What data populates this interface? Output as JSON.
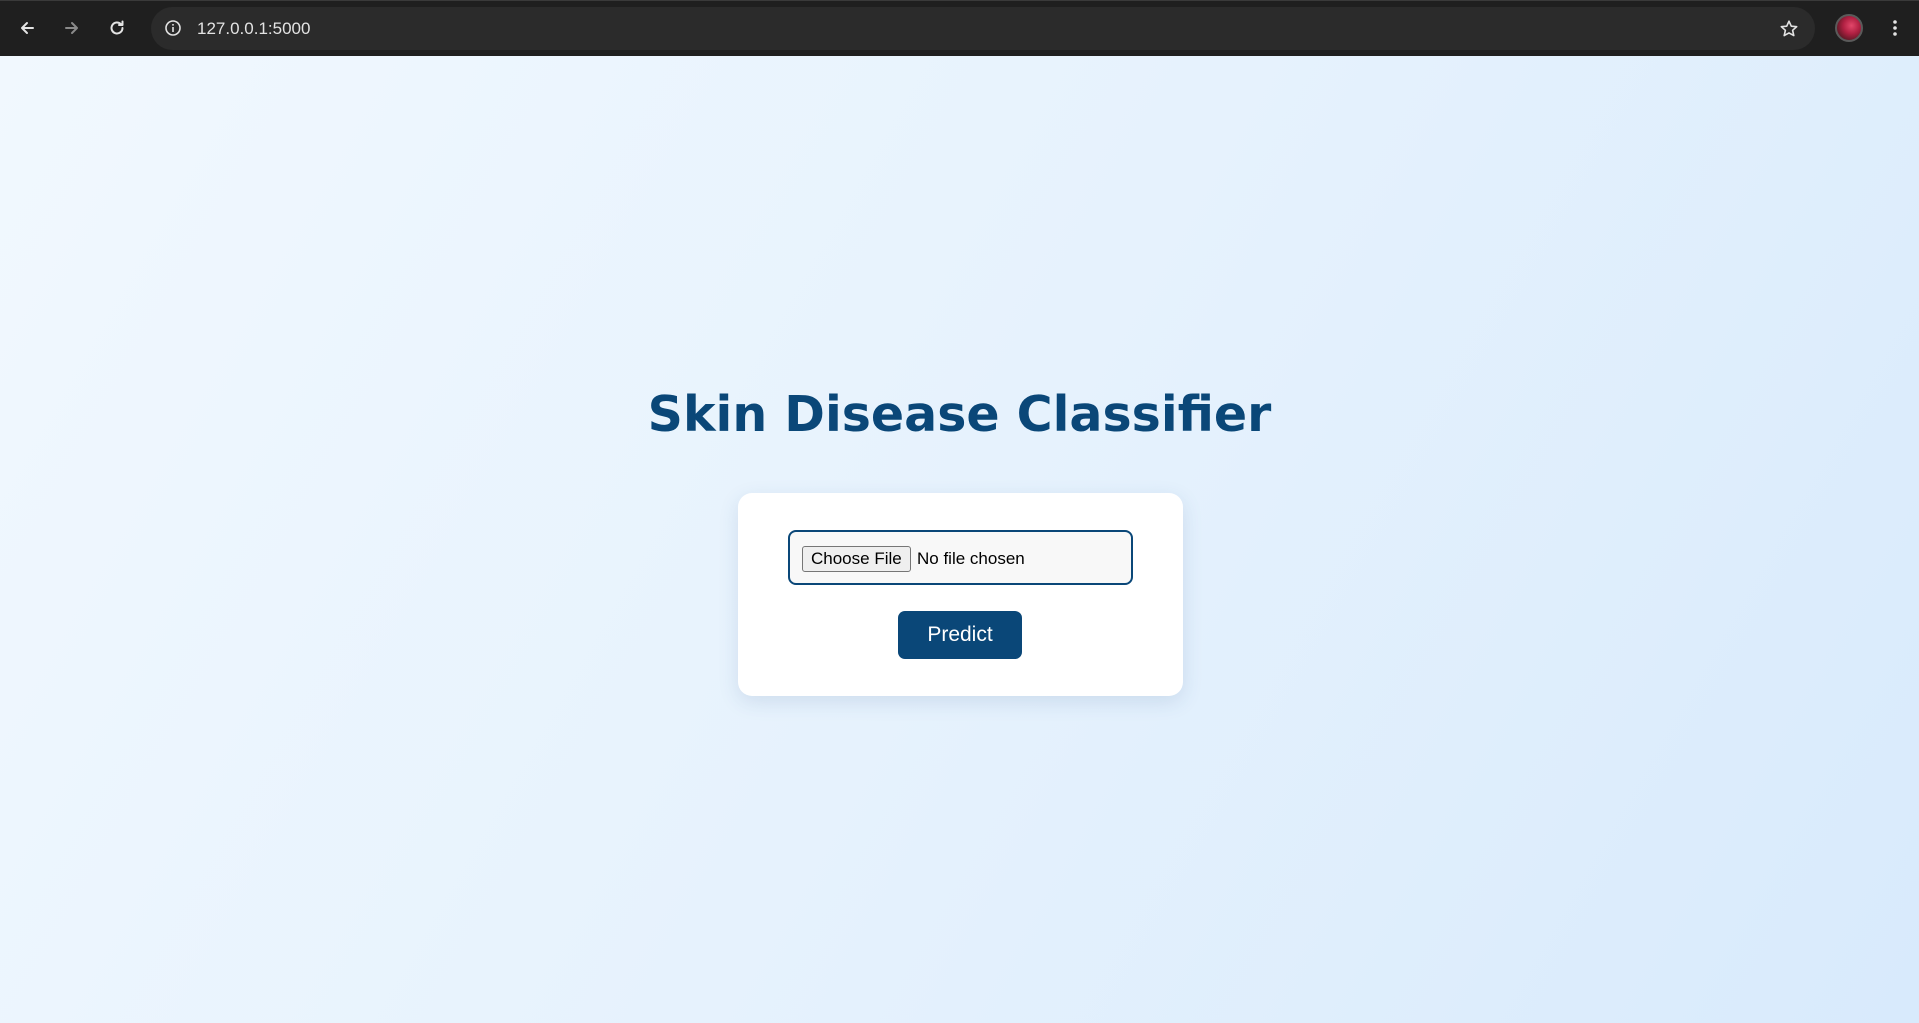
{
  "browser": {
    "url": "127.0.0.1:5000",
    "icons": {
      "back": "arrow-left-icon",
      "forward": "arrow-right-icon",
      "reload": "reload-icon",
      "site_info": "info-icon",
      "bookmark": "star-icon",
      "menu": "kebab-menu-icon"
    }
  },
  "page": {
    "title": "Skin Disease Classifier",
    "file_input": {
      "button_label": "Choose File",
      "status": "No file chosen"
    },
    "predict_label": "Predict"
  },
  "colors": {
    "brand": "#0a4778",
    "background_start": "#f1f8fe",
    "background_end": "#d8eafc",
    "card": "#ffffff"
  }
}
